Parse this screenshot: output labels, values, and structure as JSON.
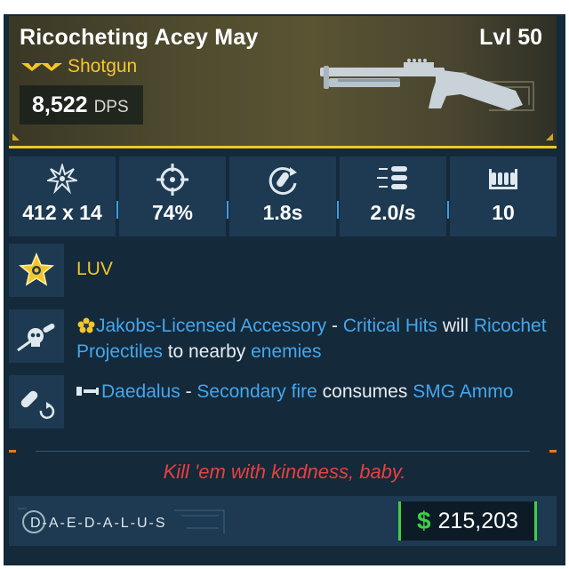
{
  "item": {
    "name": "Ricocheting Acey May",
    "level": "Lvl 50",
    "type": "Shotgun",
    "dps_value": "8,522",
    "dps_label": "DPS",
    "rarity_color": "#f4c52b"
  },
  "stats": [
    {
      "icon": "damage-burst-icon",
      "value": "412 x 14"
    },
    {
      "icon": "accuracy-crosshair-icon",
      "value": "74%"
    },
    {
      "icon": "reload-icon",
      "value": "1.8s"
    },
    {
      "icon": "fire-rate-icon",
      "value": "2.0/s"
    },
    {
      "icon": "magazine-icon",
      "value": "10"
    }
  ],
  "perks": {
    "luv": {
      "icon": "star-badge-icon",
      "text": "LUV"
    },
    "jakobs": {
      "icon": "skull-projectile-icon",
      "title": "Jakobs-Licensed Accessory",
      "dash": " - ",
      "p1": "Critical Hits",
      "p2": " will ",
      "p3": "Ricochet Projectiles",
      "p4": " to nearby ",
      "p5": "enemies"
    },
    "daedalus": {
      "icon": "ammo-swap-icon",
      "title": "Daedalus",
      "dash": " - ",
      "p1": "Secondary fire",
      "p2": " consumes ",
      "p3": "SMG Ammo"
    }
  },
  "flavor_text": "Kill 'em with kindness, baby.",
  "manufacturer": "D-A-E-D-A-L-U-S",
  "price": {
    "symbol": "$",
    "amount": "215,203"
  },
  "colors": {
    "accent_gold": "#f4c52b",
    "link_blue": "#45a6ec",
    "price_green": "#3fcf48",
    "flavor_red": "#e8403e"
  }
}
